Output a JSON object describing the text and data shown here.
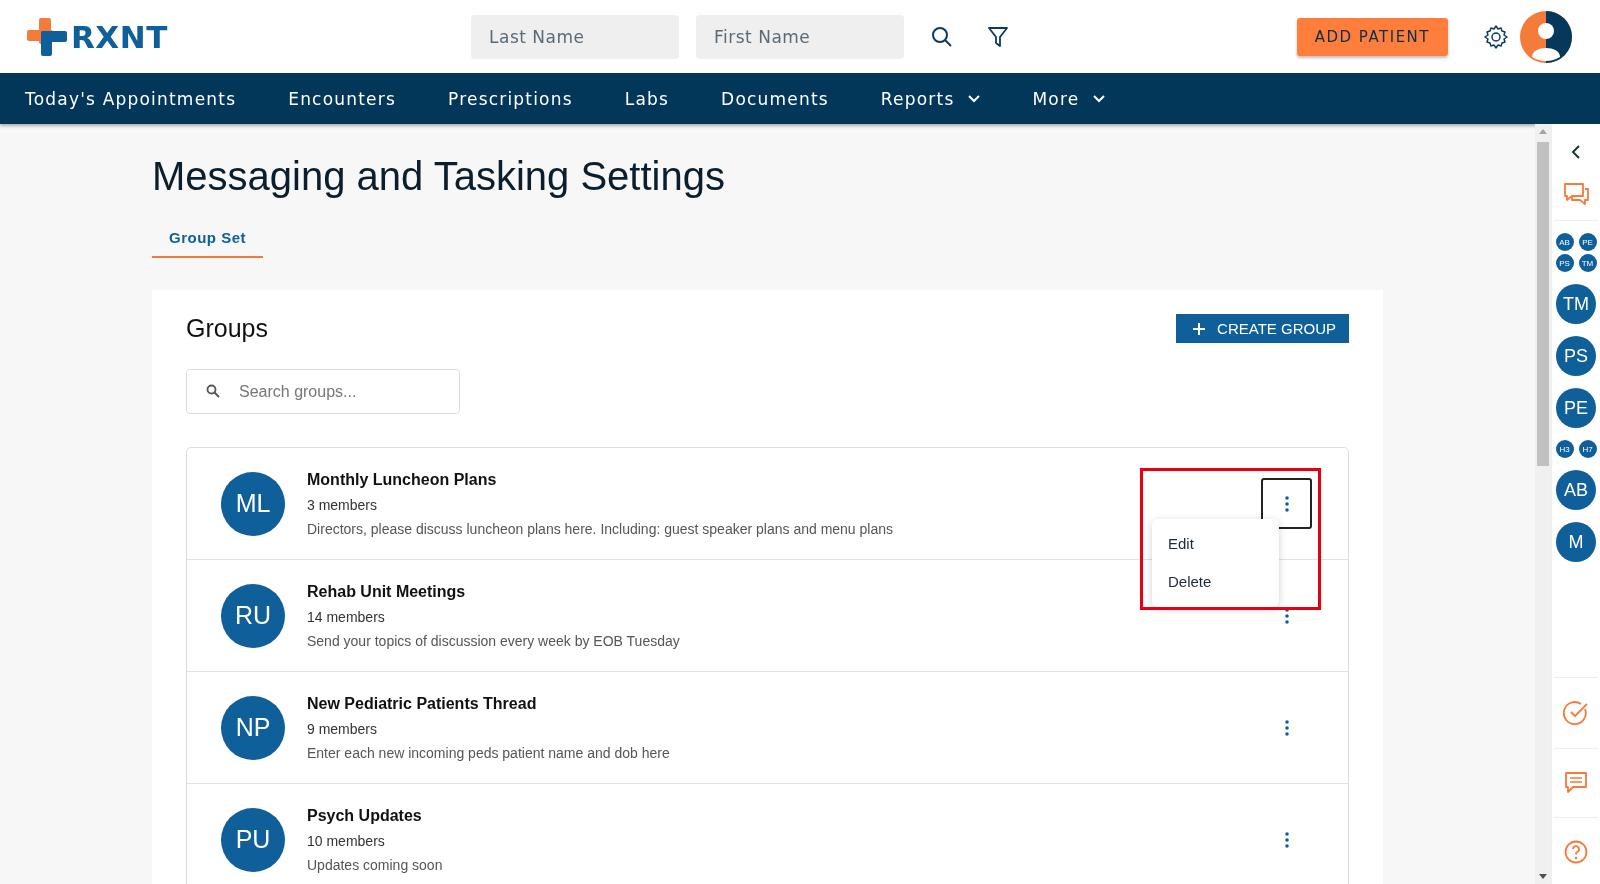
{
  "header": {
    "logo": "RXNT",
    "last_name": {
      "placeholder": "Last Name"
    },
    "first_name": {
      "placeholder": "First Name"
    },
    "add_patient": "ADD PATIENT"
  },
  "nav": [
    {
      "label": "Today's Appointments",
      "dropdown": false
    },
    {
      "label": "Encounters",
      "dropdown": false
    },
    {
      "label": "Prescriptions",
      "dropdown": false
    },
    {
      "label": "Labs",
      "dropdown": false
    },
    {
      "label": "Documents",
      "dropdown": false
    },
    {
      "label": "Reports",
      "dropdown": true
    },
    {
      "label": "More",
      "dropdown": true
    }
  ],
  "page_title": "Messaging and Tasking Settings",
  "tabs": [
    {
      "label": "Group Set",
      "selected": true
    }
  ],
  "groups": {
    "title": "Groups",
    "create_button": "CREATE GROUP",
    "search": {
      "placeholder": "Search groups..."
    },
    "items": [
      {
        "initials": "ML",
        "name": "Monthly Luncheon Plans",
        "members": "3 members",
        "description": "Directors, please discuss luncheon plans here. Including: guest speaker plans and menu plans",
        "menu_open": true
      },
      {
        "initials": "RU",
        "name": "Rehab Unit Meetings",
        "members": "14 members",
        "description": "Send your topics of discussion every week by EOB Tuesday",
        "menu_open": false
      },
      {
        "initials": "NP",
        "name": "New Pediatric Patients Thread",
        "members": "9 members",
        "description": "Enter each new incoming peds patient name and dob here",
        "menu_open": false
      },
      {
        "initials": "PU",
        "name": "Psych Updates",
        "members": "10 members",
        "description": "Updates coming soon",
        "menu_open": false
      }
    ]
  },
  "row_menu": {
    "items": [
      "Edit",
      "Delete"
    ]
  },
  "right_rail": [
    {
      "kind": "cluster",
      "initials": [
        "AB",
        "PE",
        "PS",
        "TM"
      ]
    },
    {
      "kind": "avatar",
      "initials": "TM"
    },
    {
      "kind": "avatar",
      "initials": "PS"
    },
    {
      "kind": "avatar",
      "initials": "PE"
    },
    {
      "kind": "cluster",
      "initials": [
        "H3",
        "H7"
      ]
    },
    {
      "kind": "avatar",
      "initials": "AB"
    },
    {
      "kind": "avatar",
      "initials": "M"
    }
  ]
}
